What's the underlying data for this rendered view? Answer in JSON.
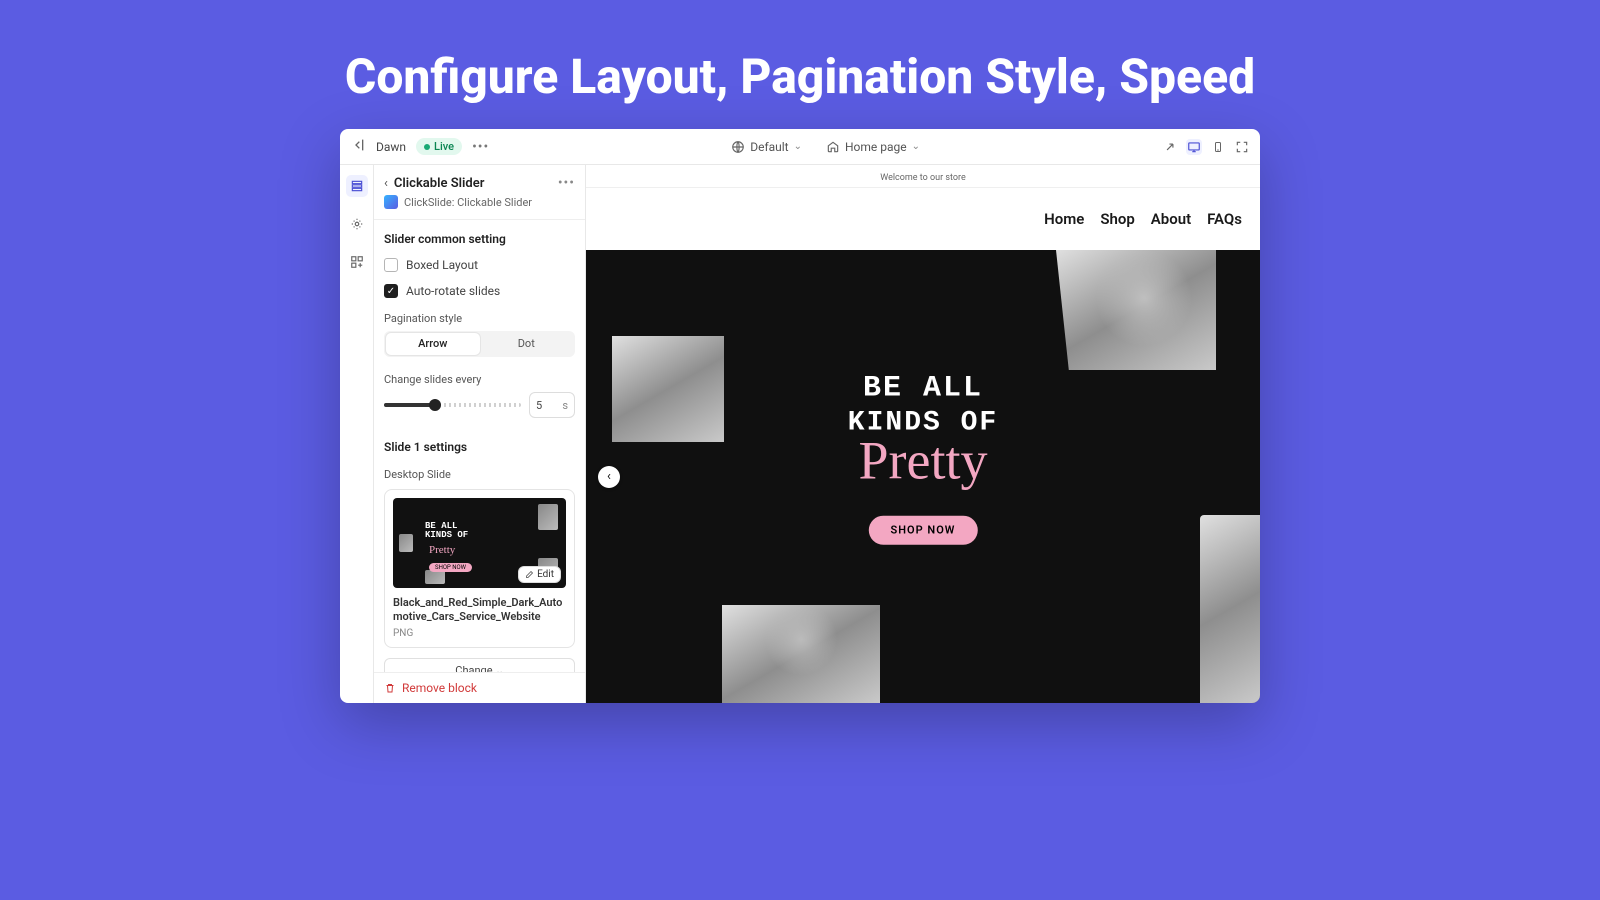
{
  "hero_title": "Configure Layout, Pagination Style, Speed",
  "toolbar": {
    "theme": "Dawn",
    "live": "Live",
    "template": "Default",
    "page": "Home page"
  },
  "panel": {
    "title": "Clickable Slider",
    "app_link": "ClickSlide: Clickable Slider",
    "common_title": "Slider common setting",
    "boxed_label": "Boxed Layout",
    "autorotate_label": "Auto-rotate slides",
    "pagination_label": "Pagination style",
    "seg_arrow": "Arrow",
    "seg_dot": "Dot",
    "change_every_label": "Change slides every",
    "interval_value": "5",
    "interval_unit": "s",
    "slide1_title": "Slide 1 settings",
    "desktop_label": "Desktop Slide",
    "edit_label": "Edit",
    "file_name": "Black_and_Red_Simple_Dark_Automotive_Cars_Service_Website",
    "file_type": "PNG",
    "change_label": "Change",
    "remove_label": "Remove block"
  },
  "store": {
    "announce": "Welcome to our store",
    "nav": [
      "Home",
      "Shop",
      "About",
      "FAQs"
    ],
    "line1": "BE ALL",
    "line2": "KINDS OF",
    "line3": "Pretty",
    "cta": "SHOP NOW"
  }
}
